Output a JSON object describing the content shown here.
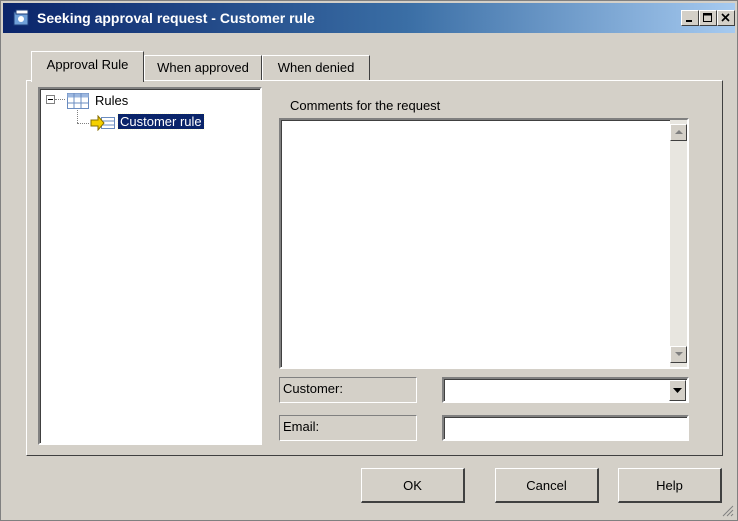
{
  "window": {
    "title": "Seeking approval request - Customer rule"
  },
  "tabs": [
    {
      "label": "Approval Rule",
      "active": true
    },
    {
      "label": "When approved",
      "active": false
    },
    {
      "label": "When denied",
      "active": false
    }
  ],
  "tree": {
    "root": {
      "label": "Rules",
      "icon": "table-icon",
      "expanded": true
    },
    "child": {
      "label": "Customer rule",
      "icon": "rule-arrow-icon",
      "selected": true
    }
  },
  "comments": {
    "label": "Comments for the request",
    "value": ""
  },
  "fields": {
    "customer_label": "Customer:",
    "customer_value": "",
    "email_label": "Email:",
    "email_value": ""
  },
  "buttons": {
    "ok": "OK",
    "cancel": "Cancel",
    "help": "Help"
  },
  "colors": {
    "titlebar_start": "#0a246a",
    "titlebar_end": "#a6caf0",
    "face": "#d4d0c8",
    "selection": "#0a246a"
  }
}
